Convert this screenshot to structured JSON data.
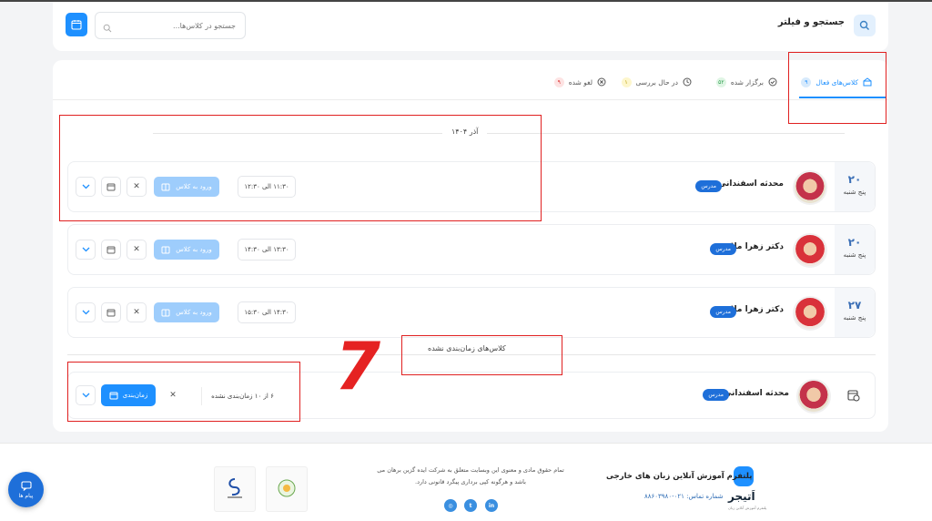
{
  "search": {
    "title": "جستجو و فیلتر",
    "placeholder": "جستجو در کلاس‌ها..."
  },
  "tabs": [
    {
      "label": "کلاس‌های فعال",
      "count": "۹",
      "active": true
    },
    {
      "label": "برگزار شده",
      "count": "۵۲"
    },
    {
      "label": "در حال بررسی",
      "count": "۱"
    },
    {
      "label": "لغو شده",
      "count": "۹"
    }
  ],
  "month": "آذر ۱۴۰۴",
  "sessions": [
    {
      "day": "۲۰",
      "weekday": "پنج شنبه",
      "teacher": "محدثه اسفندانی",
      "role": "مدرس",
      "time": "۱۱:۳۰ الی ۱۲:۳۰",
      "enter_label": "ورود به کلاس"
    },
    {
      "day": "۲۰",
      "weekday": "پنج شنبه",
      "teacher": "دکتر زهرا ملا",
      "role": "مدرس",
      "time": "۱۳:۳۰ الی ۱۴:۳۰",
      "enter_label": "ورود به کلاس"
    },
    {
      "day": "۲۷",
      "weekday": "پنج شنبه",
      "teacher": "دکتر زهرا ملا",
      "role": "مدرس",
      "time": "۱۴:۳۰ الی ۱۵:۳۰",
      "enter_label": "ورود به کلاس"
    }
  ],
  "unscheduled": {
    "heading": "کلاس‌های زمان‌بندی نشده",
    "teacher": "محدثه اسفندانی",
    "role": "مدرس",
    "count_text": "۶ از ۱۰ زمان‌بندی نشده",
    "schedule_label": "زمان‌بندی"
  },
  "annotation_number": "7",
  "footer": {
    "brand": "اَتیجر",
    "brand_sub": "پلتفرم آموزش آنلاین زبان",
    "platform_title": "پلتفرم آموزش آنلاین زبان های خارجی",
    "phone": "شماره تماس: ۰۲۱-۸۸۶۰۳۹۸۰",
    "copyright": "تمام حقوق مادی و معنوی این وبسایت متعلق به شرکت ایده گزین برهان می باشد و هرگونه کپی برداری پیگرد قانونی دارد.",
    "social": [
      "instagram-icon",
      "twitter-icon",
      "linkedin-icon"
    ]
  },
  "chat_label": "پیام ها",
  "colors": {
    "accent": "#1e90ff",
    "annotation": "#e02020"
  }
}
